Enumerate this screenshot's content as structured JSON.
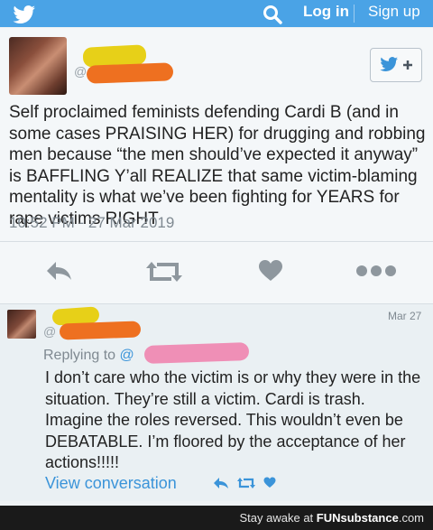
{
  "topbar": {
    "login_label": "Log in",
    "signup_label": "Sign up",
    "bird_icon": "twitter-bird-icon",
    "search_icon": "search-icon"
  },
  "tweet": {
    "text": "Self proclaimed feminists defending Cardi B (and in some cases PRAISING HER) for drugging and robbing men because “the men should’ve expected it anyway” is BAFFLING Y’all REALIZE that same victim-blaming mentality is what we’ve been fighting for YEARS for rape victims RIGHT",
    "timestamp": "10:52 PM - 27 Mar 2019",
    "actions": [
      "reply-icon",
      "retweet-icon",
      "like-icon",
      "more-icon"
    ]
  },
  "reply": {
    "date": "Mar 27",
    "replying_to_label": "Replying to",
    "replying_to_handle": "@",
    "text": "I don’t care who the victim is or why they were in the situation. They’re still a victim. Cardi is trash. Imagine the roles reversed. This wouldn’t even be DEBATABLE. I’m floored by the acceptance of her actions!!!!!",
    "view_conversation_label": "View conversation"
  },
  "footer": {
    "prefix": "Stay awake at",
    "brand": "FUNsubstance",
    "suffix": ".com"
  },
  "colors": {
    "topbar": "#4aa3e6",
    "link": "#3b94d9",
    "muted": "#7f8991"
  }
}
